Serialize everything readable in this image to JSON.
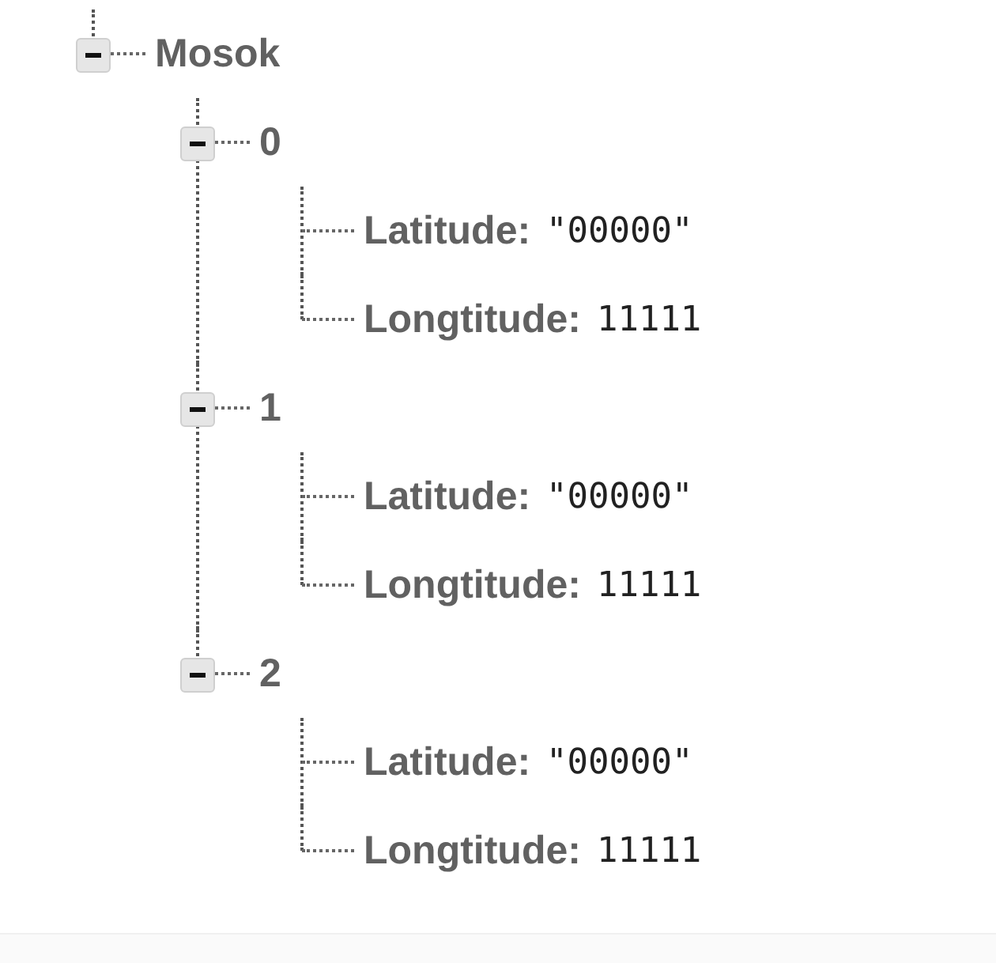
{
  "tree": [
    {
      "kind": "node",
      "label": "Mosok",
      "expanded": true,
      "children": [
        {
          "kind": "node",
          "label": "0",
          "expanded": true,
          "children": [
            {
              "kind": "leaf",
              "key": "Latitude:",
              "value": "\"00000\""
            },
            {
              "kind": "leaf",
              "key": "Longtitude:",
              "value": "11111"
            }
          ]
        },
        {
          "kind": "node",
          "label": "1",
          "expanded": true,
          "children": [
            {
              "kind": "leaf",
              "key": "Latitude:",
              "value": "\"00000\""
            },
            {
              "kind": "leaf",
              "key": "Longtitude:",
              "value": "11111"
            }
          ]
        },
        {
          "kind": "node",
          "label": "2",
          "expanded": true,
          "children": [
            {
              "kind": "leaf",
              "key": "Latitude:",
              "value": "\"00000\""
            },
            {
              "kind": "leaf",
              "key": "Longtitude:",
              "value": "11111"
            }
          ]
        }
      ]
    }
  ]
}
